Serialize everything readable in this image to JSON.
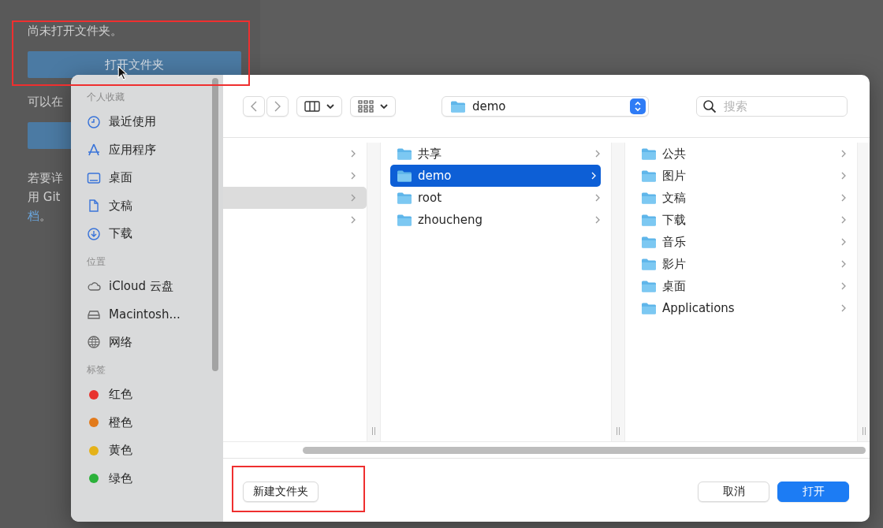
{
  "panel": {
    "message": "尚未打开文件夹。",
    "open_button": "打开文件夹",
    "hint": "可以在",
    "lines": [
      {
        "text": "若要详"
      },
      {
        "text": "用 Git"
      },
      {
        "link": "档",
        "text": "。"
      }
    ]
  },
  "dialog": {
    "sidebar": [
      {
        "header": "个人收藏",
        "items": [
          {
            "kind": "clock",
            "label": "最近使用"
          },
          {
            "kind": "apps",
            "label": "应用程序"
          },
          {
            "kind": "desktop",
            "label": "桌面"
          },
          {
            "kind": "document",
            "label": "文稿"
          },
          {
            "kind": "download",
            "label": "下载"
          }
        ]
      },
      {
        "header": "位置",
        "items": [
          {
            "kind": "cloud",
            "label": "iCloud 云盘"
          },
          {
            "kind": "disk",
            "label": "Macintosh..."
          },
          {
            "kind": "globe",
            "label": "网络"
          }
        ]
      },
      {
        "header": "标签",
        "items": [
          {
            "kind": "tag",
            "label": "红色",
            "color": "#e8332e"
          },
          {
            "kind": "tag",
            "label": "橙色",
            "color": "#e27a1b"
          },
          {
            "kind": "tag",
            "label": "黄色",
            "color": "#e5b219"
          },
          {
            "kind": "tag",
            "label": "绿色",
            "color": "#2bb13a"
          }
        ]
      }
    ],
    "location": "demo",
    "search": {
      "placeholder": "搜索"
    },
    "columns": [
      [
        {
          "selected": false
        },
        {
          "selected": false
        },
        {
          "selected": true
        },
        {
          "selected": false
        }
      ],
      [
        {
          "name": "共享",
          "selected": false
        },
        {
          "name": "demo",
          "selected": true
        },
        {
          "name": "root",
          "selected": false
        },
        {
          "name": "zhoucheng",
          "selected": false
        }
      ],
      [
        {
          "name": "公共",
          "selected": false
        },
        {
          "name": "图片",
          "selected": false
        },
        {
          "name": "文稿",
          "selected": false
        },
        {
          "name": "下载",
          "selected": false
        },
        {
          "name": "音乐",
          "selected": false
        },
        {
          "name": "影片",
          "selected": false
        },
        {
          "name": "桌面",
          "selected": false
        },
        {
          "name": "Applications",
          "selected": false
        }
      ]
    ],
    "new_folder": "新建文件夹",
    "cancel": "取消",
    "open": "打开"
  }
}
